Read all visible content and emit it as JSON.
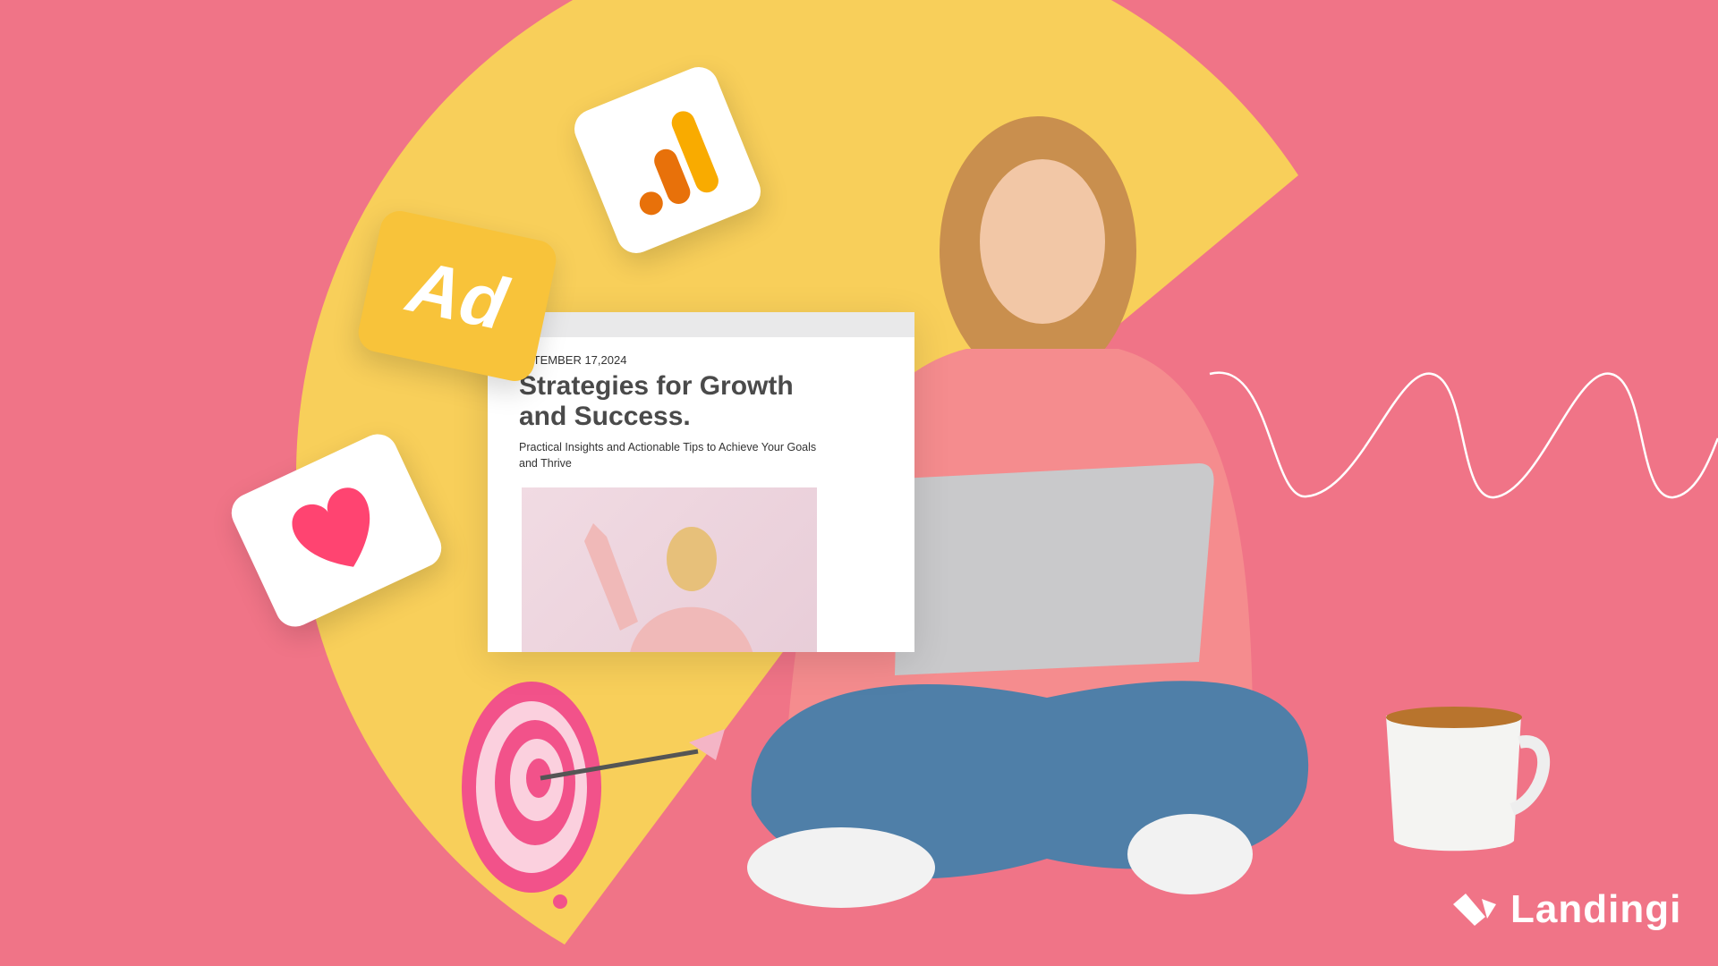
{
  "colors": {
    "background": "#f07487",
    "accent_yellow": "#f8cf5a",
    "ad_tile": "#f8c33a",
    "heart": "#ff4471",
    "analytics_orange": "#e8710a",
    "analytics_yellow": "#f9ab00"
  },
  "blog_card": {
    "date": "PTEMBER 17,2024",
    "title": "Strategies for Growth and Success.",
    "subtitle": "Practical Insights and Actionable Tips to Achieve Your Goals and Thrive"
  },
  "ad_tile": {
    "label": "Ad"
  },
  "icons": [
    "analytics-icon",
    "heart-icon",
    "target-icon",
    "coffee-mug",
    "landingi-logo-icon"
  ],
  "brand": {
    "name": "Landingi"
  }
}
